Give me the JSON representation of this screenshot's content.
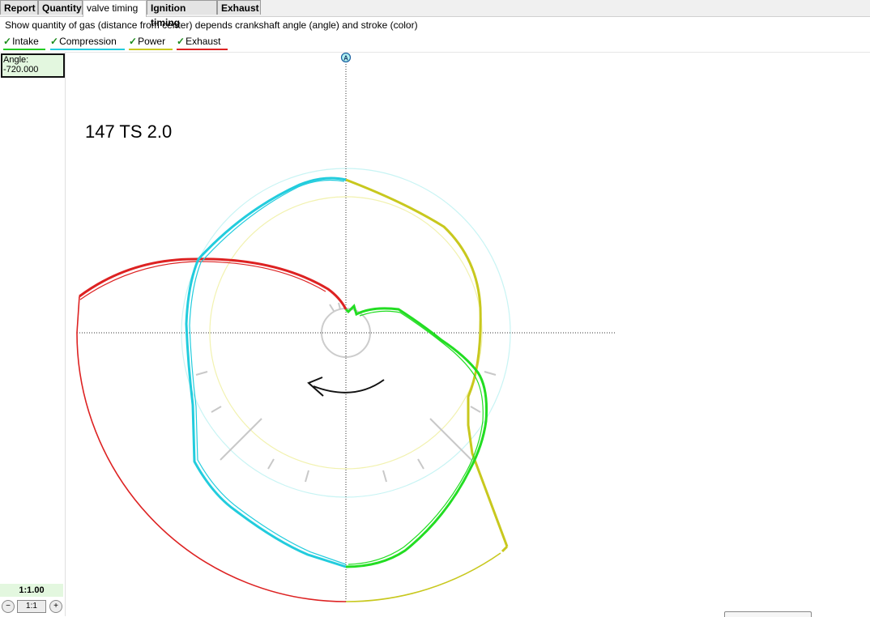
{
  "tabs": [
    {
      "label": "Report",
      "active": false
    },
    {
      "label": "Quantity",
      "active": false
    },
    {
      "label": "valve timing",
      "active": true
    },
    {
      "label": "Ignition timing",
      "active": false
    },
    {
      "label": "Exhaust",
      "active": false
    }
  ],
  "description": "Show quantity of gas (distance from center) depends crankshaft angle (angle) and stroke (color)",
  "legend": [
    {
      "label": "Intake",
      "color": "#22cc22",
      "checked": true
    },
    {
      "label": "Compression",
      "color": "#22ccdd",
      "checked": true
    },
    {
      "label": "Power",
      "color": "#c8c81e",
      "checked": true
    },
    {
      "label": "Exhaust",
      "color": "#dd2222",
      "checked": true
    }
  ],
  "angle": {
    "label": "Angle:",
    "value": "-720.000"
  },
  "zoom": {
    "level": "1:1.00",
    "minus_icon": "minus-circle-icon",
    "reset_label": "1:1",
    "plus_icon": "plus-circle-icon"
  },
  "chart_title": "147 TS 2.0",
  "marker_label": "A",
  "chart_data": {
    "type": "polar-line",
    "title": "147 TS 2.0",
    "rotation": "counter-clockwise",
    "series": [
      {
        "name": "Intake",
        "color": "#22dd22"
      },
      {
        "name": "Compression",
        "color": "#22ccdd"
      },
      {
        "name": "Power",
        "color": "#c8c81e"
      },
      {
        "name": "Exhaust",
        "color": "#dd2222"
      }
    ]
  }
}
